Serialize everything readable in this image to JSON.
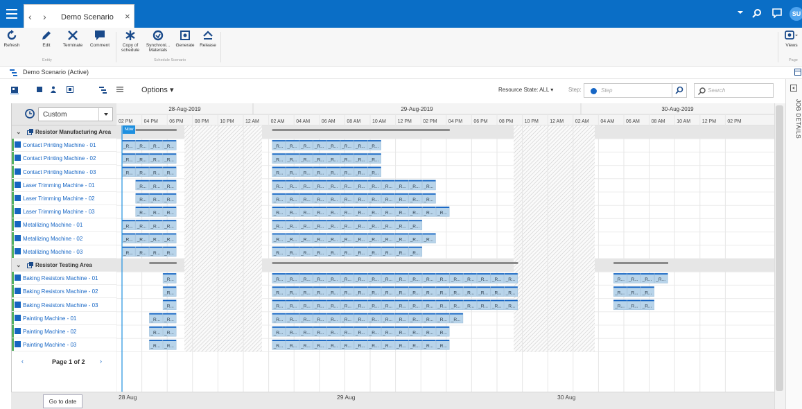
{
  "titlebar": {
    "tab_title": "Demo Scenario",
    "back_glyph": "‹",
    "fwd_glyph": "›",
    "close_glyph": "×",
    "avatar_initials": "SU",
    "bg_color": "#0a6ec6"
  },
  "ribbon": {
    "refresh": "Refresh",
    "edit": "Edit",
    "terminate": "Terminate",
    "comment": "Comment",
    "group_entity": "Entity",
    "copy_of_schedule_1": "Copy of",
    "copy_of_schedule_2": "schedule",
    "synchronize_1": "Synchroni...",
    "synchronize_2": "Materials",
    "generate": "Generate",
    "release": "Release",
    "group_schedule": "Schedule Scenario",
    "views": "Views",
    "group_page": "Page"
  },
  "breadcrumb": {
    "text": "Demo Scenario (Active)"
  },
  "toolbar": {
    "options": "Options ▾",
    "resource_state": "Resource State: ALL ▾",
    "step_label": "Step:",
    "step_placeholder": "Step",
    "search_placeholder": "Search"
  },
  "rightrail": {
    "job_details": "JOB DETAILS"
  },
  "leftpanel": {
    "custom_label": "Custom"
  },
  "timeline": {
    "day_labels": [
      "28-Aug-2019",
      "29-Aug-2019",
      "30-Aug-2019"
    ],
    "hour_labels": [
      "02 PM",
      "04 PM",
      "06 PM",
      "08 PM",
      "10 PM",
      "12 AM",
      "02 AM",
      "04 AM",
      "06 AM",
      "08 AM",
      "10 AM",
      "12 PM",
      "02 PM",
      "04 PM",
      "06 PM",
      "08 PM",
      "10 PM",
      "12 AM",
      "02 AM",
      "04 AM",
      "06 AM",
      "08 AM",
      "10 AM",
      "12 PM",
      "02 PM"
    ],
    "now_label": "Now",
    "task_label": "_R..."
  },
  "rows": [
    {
      "label": "Resistor Manufacturing Area",
      "type": "group",
      "bars": [
        [
          1,
          4
        ],
        [
          11,
          24
        ]
      ],
      "tasks": []
    },
    {
      "label": "Contact Printing Machine - 01",
      "type": "machine",
      "tasks": [
        [
          0,
          4
        ],
        [
          11,
          19
        ]
      ]
    },
    {
      "label": "Contact Printing Machine - 02",
      "type": "machine",
      "tasks": [
        [
          0,
          4
        ],
        [
          11,
          19
        ]
      ]
    },
    {
      "label": "Contact Printing Machine - 03",
      "type": "machine",
      "tasks": [
        [
          0,
          4
        ],
        [
          11,
          19
        ]
      ]
    },
    {
      "label": "Laser Trimming Machine - 01",
      "type": "machine",
      "tasks": [
        [
          1,
          4
        ],
        [
          11,
          23
        ]
      ]
    },
    {
      "label": "Laser Trimming Machine - 02",
      "type": "machine",
      "tasks": [
        [
          1,
          4
        ],
        [
          11,
          23
        ]
      ]
    },
    {
      "label": "Laser Trimming Machine - 03",
      "type": "machine",
      "tasks": [
        [
          1,
          4
        ],
        [
          11,
          24
        ]
      ]
    },
    {
      "label": "Metallizing Machine - 01",
      "type": "machine",
      "tasks": [
        [
          0,
          4
        ],
        [
          11,
          22
        ]
      ]
    },
    {
      "label": "Metallizing Machine - 02",
      "type": "machine",
      "tasks": [
        [
          0,
          4
        ],
        [
          11,
          23
        ]
      ]
    },
    {
      "label": "Metallizing Machine - 03",
      "type": "machine",
      "tasks": [
        [
          0,
          4
        ],
        [
          11,
          22
        ]
      ]
    },
    {
      "label": "Resistor Testing Area",
      "type": "group",
      "bars": [
        [
          2,
          4
        ],
        [
          11,
          29
        ],
        [
          36,
          40
        ]
      ],
      "tasks": []
    },
    {
      "label": "Baking Resistors Machine - 01",
      "type": "machine",
      "tasks": [
        [
          3,
          4
        ],
        [
          11,
          29
        ],
        [
          36,
          40
        ]
      ]
    },
    {
      "label": "Baking Resistors Machine - 02",
      "type": "machine",
      "tasks": [
        [
          3,
          4
        ],
        [
          11,
          29
        ],
        [
          36,
          39
        ]
      ]
    },
    {
      "label": "Baking Resistors Machine - 03",
      "type": "machine",
      "tasks": [
        [
          3,
          4
        ],
        [
          11,
          29
        ],
        [
          36,
          39
        ]
      ]
    },
    {
      "label": "Painting Machine - 01",
      "type": "machine",
      "tasks": [
        [
          2,
          4
        ],
        [
          11,
          25
        ]
      ]
    },
    {
      "label": "Painting Machine - 02",
      "type": "machine",
      "tasks": [
        [
          2,
          4
        ],
        [
          11,
          24
        ]
      ]
    },
    {
      "label": "Painting Machine - 03",
      "type": "machine",
      "tasks": [
        [
          2,
          4
        ],
        [
          11,
          24
        ]
      ]
    }
  ],
  "pager": {
    "text": "Page 1 of 2",
    "prev_glyph": "‹",
    "next_glyph": "›"
  },
  "bottom": {
    "goto": "Go to date",
    "dates": [
      "28 Aug",
      "29 Aug",
      "30 Aug"
    ]
  },
  "colors": {
    "accent": "#0a6ec6",
    "task": "#b8d4ea",
    "task_top": "#1666c5",
    "group_bar": "#8a8a8a",
    "hatch": "#d0d0d0"
  }
}
